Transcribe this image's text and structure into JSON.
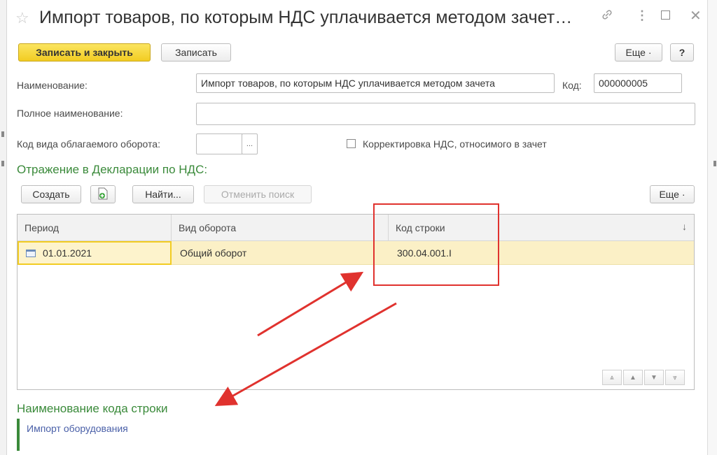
{
  "window": {
    "title": "Импорт товаров, по которым НДС уплачивается методом зачет…",
    "star_icon": "star-icon",
    "link_icon": "link-icon",
    "more_icon": "more-vert-icon",
    "maximize_icon": "maximize-icon",
    "close_icon": "close-icon"
  },
  "toolbar": {
    "save_close_label": "Записать и закрыть",
    "save_label": "Записать",
    "more_label": "Еще ·",
    "help_label": "?"
  },
  "form": {
    "name_label": "Наименование:",
    "name_value": "Импорт товаров, по которым НДС уплачивается методом зачета",
    "code_label": "Код:",
    "code_value": "000000005",
    "fullname_label": "Полное наименование:",
    "fullname_value": "",
    "turnover_code_label": "Код вида облагаемого оборота:",
    "turnover_code_value": "",
    "pick_label": "...",
    "vat_correction_label": "Корректировка НДС, относимого в зачет",
    "vat_correction_checked": false
  },
  "declaration": {
    "section_title": "Отражение в Декларации по НДС:",
    "create_label": "Создать",
    "find_label": "Найти...",
    "cancel_search_label": "Отменить поиск",
    "more_label": "Еще ·",
    "columns": [
      "Период",
      "Вид оборота",
      "Код строки"
    ],
    "rows": [
      {
        "period": "01.01.2021",
        "turnover_type": "Общий оборот",
        "line_code": "300.04.001.I"
      }
    ]
  },
  "footer": {
    "section_title": "Наименование кода строки",
    "value": "Импорт оборудования"
  },
  "colors": {
    "accent_green": "#3a8a3a",
    "primary_yellow": "#f2cc22",
    "annotation_red": "#e0322e",
    "row_highlight": "#fbf0c6"
  }
}
